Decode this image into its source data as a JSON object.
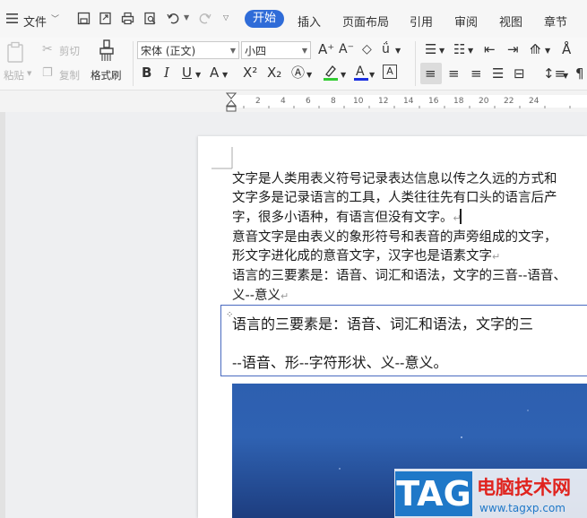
{
  "menu": {
    "file": "文件",
    "tabs": [
      "开始",
      "插入",
      "页面布局",
      "引用",
      "审阅",
      "视图",
      "章节"
    ]
  },
  "ribbon": {
    "paste": "粘贴",
    "cut": "剪切",
    "copy": "复制",
    "format_painter": "格式刷",
    "font_name": "宋体 (正文)",
    "font_size": "小四"
  },
  "ruler": {
    "numbers": [
      "2",
      "4",
      "6",
      "8",
      "10",
      "12",
      "14",
      "16",
      "18",
      "20",
      "22",
      "24"
    ]
  },
  "document": {
    "lines": [
      "文字是人类用表义符号记录表达信息以传之久远的方式和",
      "文字多是记录语言的工具，人类往往先有口头的语言后产",
      "字，很多小语种，有语言但没有文字。",
      "意音文字是由表义的象形符号和表音的声旁组成的文字，",
      "形文字进化成的意音文字，汉字也是语素文字",
      "语言的三要素是：语音、词汇和语法，文字的三音--语音、",
      "义--意义"
    ],
    "textbox_lines": [
      "语言的三要素是：语音、词汇和语法，文字的三",
      "--语音、形--字符形状、义--意义。"
    ]
  },
  "watermark": {
    "tag": "TAG",
    "site_name": "电脑技术网",
    "url": "www.tagxp.com"
  },
  "colors": {
    "accent": "#2f6cd8",
    "textbox_border": "#4a6ac0",
    "watermark_blue": "#1f78c8",
    "watermark_red": "#e0231e"
  }
}
